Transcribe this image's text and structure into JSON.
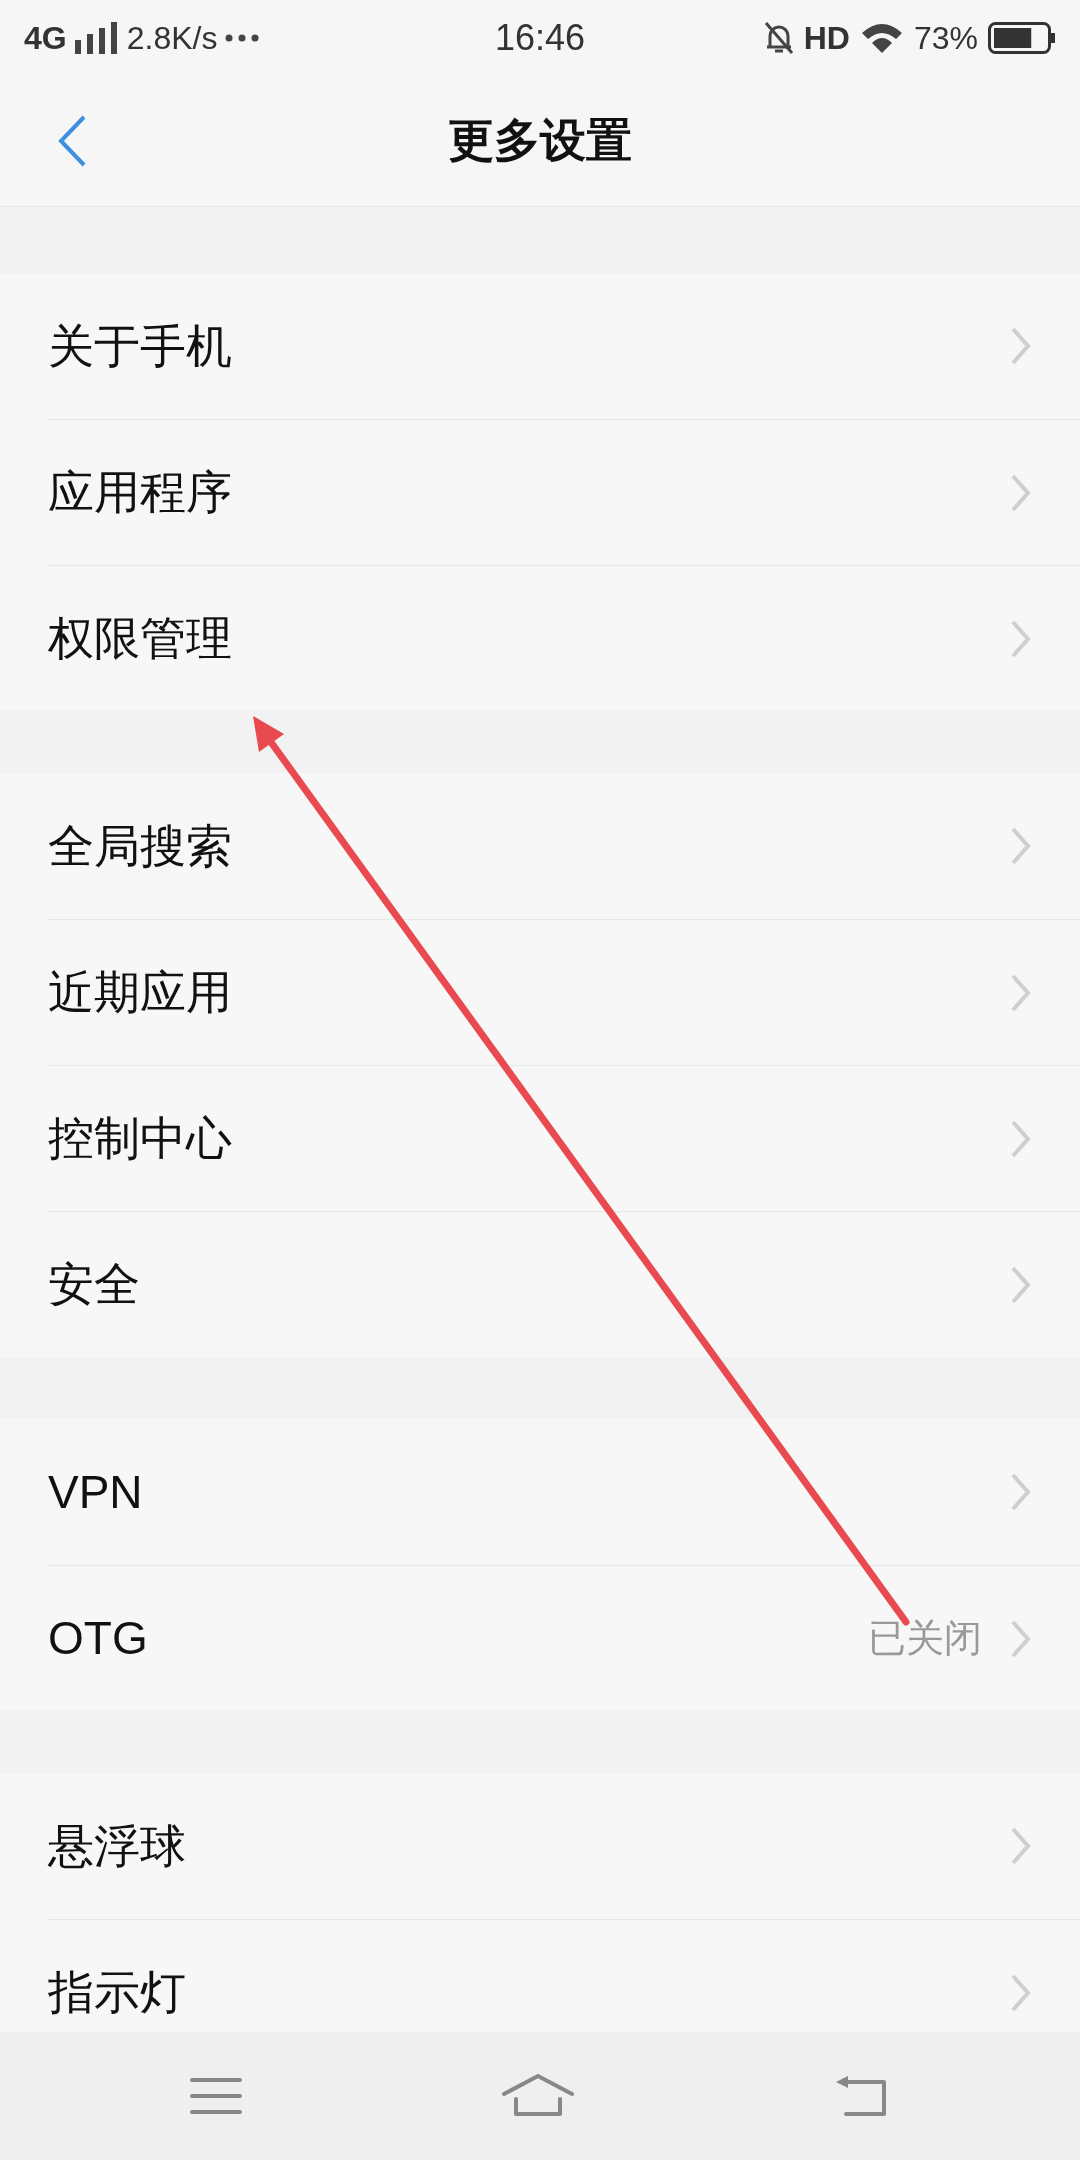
{
  "status_bar": {
    "network": "4G",
    "speed": "2.8K/s",
    "time": "16:46",
    "hd": "HD",
    "battery_percent": "73%",
    "battery": {
      "level": 0.73
    }
  },
  "header": {
    "title": "更多设置"
  },
  "sections": [
    {
      "items": [
        {
          "label": "关于手机"
        },
        {
          "label": "应用程序"
        },
        {
          "label": "权限管理"
        }
      ]
    },
    {
      "items": [
        {
          "label": "全局搜索"
        },
        {
          "label": "近期应用"
        },
        {
          "label": "控制中心"
        },
        {
          "label": "安全"
        }
      ]
    },
    {
      "items": [
        {
          "label": "VPN"
        },
        {
          "label": "OTG",
          "value": "已关闭"
        }
      ]
    },
    {
      "items": [
        {
          "label": "悬浮球"
        },
        {
          "label": "指示灯"
        }
      ]
    }
  ]
}
